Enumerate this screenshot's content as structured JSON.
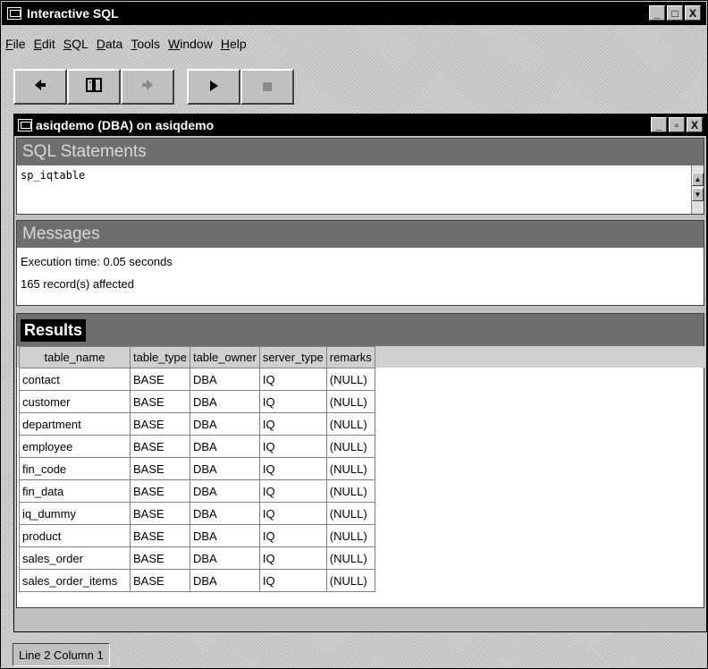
{
  "window": {
    "title": "Interactive SQL",
    "controls": [
      "_",
      "□",
      "X"
    ]
  },
  "menu": [
    {
      "pre": "",
      "u": "F",
      "post": "ile"
    },
    {
      "pre": "",
      "u": "E",
      "post": "dit"
    },
    {
      "pre": "",
      "u": "S",
      "post": "QL"
    },
    {
      "pre": "",
      "u": "D",
      "post": "ata"
    },
    {
      "pre": "",
      "u": "T",
      "post": "ools"
    },
    {
      "pre": "",
      "u": "W",
      "post": "indow"
    },
    {
      "pre": "",
      "u": "H",
      "post": "elp"
    }
  ],
  "toolbar": {
    "back_icon": "◆",
    "book_icon": "⌷",
    "forward_icon": "➡",
    "execute_icon": "▶",
    "stop_icon": "■"
  },
  "child": {
    "title": "asiqdemo (DBA) on asiqdemo",
    "controls": [
      "_",
      "▫",
      "X"
    ]
  },
  "sql": {
    "heading": "SQL Statements",
    "text": "sp_iqtable"
  },
  "messages": {
    "heading": "Messages",
    "lines": [
      "Execution time: 0.05 seconds",
      "165 record(s) affected"
    ]
  },
  "results": {
    "heading": "Results",
    "columns": [
      "table_name",
      "table_type",
      "table_owner",
      "server_type",
      "remarks"
    ],
    "rows": [
      [
        "contact",
        "BASE",
        "DBA",
        "IQ",
        "(NULL)"
      ],
      [
        "customer",
        "BASE",
        "DBA",
        "IQ",
        "(NULL)"
      ],
      [
        "department",
        "BASE",
        "DBA",
        "IQ",
        "(NULL)"
      ],
      [
        "employee",
        "BASE",
        "DBA",
        "IQ",
        "(NULL)"
      ],
      [
        "fin_code",
        "BASE",
        "DBA",
        "IQ",
        "(NULL)"
      ],
      [
        "fin_data",
        "BASE",
        "DBA",
        "IQ",
        "(NULL)"
      ],
      [
        "iq_dummy",
        "BASE",
        "DBA",
        "IQ",
        "(NULL)"
      ],
      [
        "product",
        "BASE",
        "DBA",
        "IQ",
        "(NULL)"
      ],
      [
        "sales_order",
        "BASE",
        "DBA",
        "IQ",
        "(NULL)"
      ],
      [
        "sales_order_items",
        "BASE",
        "DBA",
        "IQ",
        "(NULL)"
      ]
    ]
  },
  "status": {
    "position": "Line 2  Column 1"
  }
}
